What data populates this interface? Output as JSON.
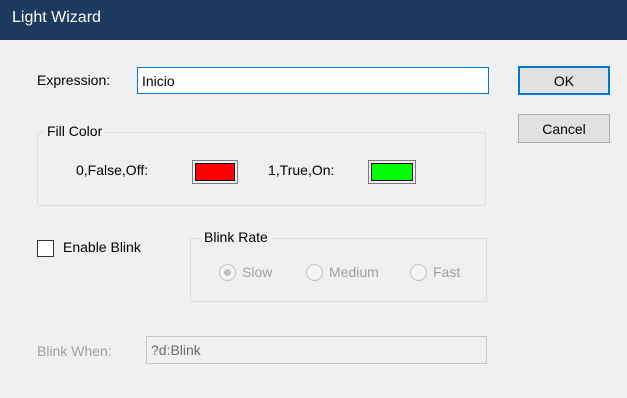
{
  "window": {
    "title": "Light Wizard"
  },
  "expression": {
    "label": "Expression:",
    "value": "Inicio"
  },
  "buttons": {
    "ok": "OK",
    "cancel": "Cancel"
  },
  "fill_color": {
    "group_label": "Fill Color",
    "false_label": "0,False,Off:",
    "false_color": "#ff0000",
    "true_label": "1,True,On:",
    "true_color": "#00ff00"
  },
  "enable_blink": {
    "label": "Enable Blink",
    "checked": false
  },
  "blink_rate": {
    "group_label": "Blink Rate",
    "options": [
      "Slow",
      "Medium",
      "Fast"
    ],
    "selected": "Slow",
    "enabled": false
  },
  "blink_when": {
    "label": "Blink When:",
    "value": "?d:Blink",
    "enabled": false
  },
  "colors": {
    "titlebar": "#1e3a5f",
    "focus_border": "#0078d7"
  }
}
